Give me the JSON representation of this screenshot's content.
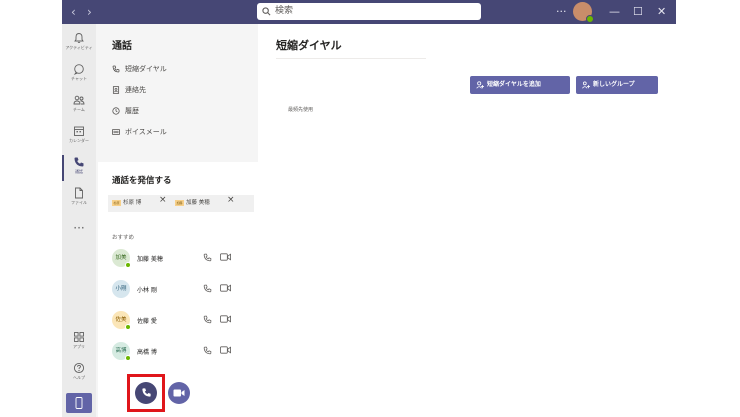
{
  "titlebar": {
    "back": "‹",
    "forward": "›",
    "search_placeholder": "検索",
    "more": "···",
    "minimize": "—",
    "maximize": "☐",
    "close": "✕"
  },
  "rail": {
    "items": [
      {
        "label": "アクティビティ",
        "icon": "bell-icon"
      },
      {
        "label": "チャット",
        "icon": "chat-icon"
      },
      {
        "label": "チーム",
        "icon": "teams-icon"
      },
      {
        "label": "カレンダー",
        "icon": "calendar-icon"
      },
      {
        "label": "通話",
        "icon": "phone-icon",
        "active": true
      },
      {
        "label": "ファイル",
        "icon": "file-icon"
      }
    ],
    "more": "···",
    "bottom": [
      {
        "label": "アプリ",
        "icon": "apps-icon"
      },
      {
        "label": "ヘルプ",
        "icon": "help-icon"
      }
    ]
  },
  "left": {
    "title": "通話",
    "nav": [
      {
        "label": "短縮ダイヤル",
        "icon": "speed-dial-icon"
      },
      {
        "label": "連絡先",
        "icon": "contacts-icon"
      },
      {
        "label": "履歴",
        "icon": "history-icon"
      },
      {
        "label": "ボイスメール",
        "icon": "voicemail-icon"
      }
    ],
    "dial": {
      "title": "通話を発信する",
      "chips": [
        {
          "avatar": "杉原",
          "name": "杉原 博"
        },
        {
          "avatar": "加藤",
          "name": "加藤 美穂"
        }
      ],
      "suggested_heading": "おすすめ",
      "suggestions": [
        {
          "initials": "加美",
          "name": "加藤 美穂",
          "avatar_color": "#dbe9d3",
          "text_color": "#3a6b22",
          "online": true
        },
        {
          "initials": "小剛",
          "name": "小林 剛",
          "avatar_color": "#d6e6ee",
          "text_color": "#2c5e78",
          "online": false
        },
        {
          "initials": "佐美",
          "name": "佐藤 愛",
          "avatar_color": "#fbe6b8",
          "text_color": "#8a5c00",
          "online": true
        },
        {
          "initials": "高博",
          "name": "高橋 博",
          "avatar_color": "#d6ebe2",
          "text_color": "#2a6b52",
          "online": true
        }
      ]
    }
  },
  "main": {
    "title": "短縮ダイヤル",
    "add_button": "短縮ダイヤルを追加",
    "new_group_button": "新しいグループ",
    "empty_text": "最頻先使用"
  }
}
